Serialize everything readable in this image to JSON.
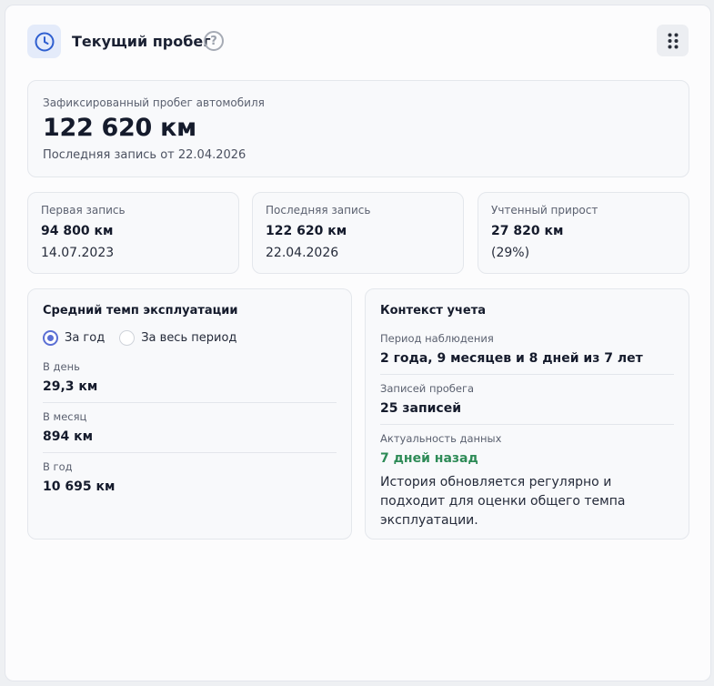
{
  "header": {
    "title": "Текущий пробег",
    "help_glyph": "?",
    "clock_icon": "clock-icon",
    "menu_icon": "grip-dots-icon"
  },
  "current": {
    "label": "Зафиксированный пробег автомобиля",
    "value": "122 620 км",
    "last_record": "Последняя запись от 22.04.2026"
  },
  "stats": [
    {
      "label": "Первая запись",
      "value": "94 800 км",
      "sub": "14.07.2023"
    },
    {
      "label": "Последняя запись",
      "value": "122 620 км",
      "sub": "22.04.2026"
    },
    {
      "label": "Учтенный прирост",
      "value": "27 820 км",
      "sub": "(29%)"
    }
  ],
  "tempo": {
    "title": "Средний темп эксплуатации",
    "options": [
      {
        "label": "За год",
        "selected": true
      },
      {
        "label": "За весь период",
        "selected": false
      }
    ],
    "metrics": [
      {
        "label": "В день",
        "value": "29,3 км"
      },
      {
        "label": "В месяц",
        "value": "894 км"
      },
      {
        "label": "В год",
        "value": "10 695 км"
      }
    ]
  },
  "context": {
    "title": "Контекст учета",
    "period_label": "Период наблюдения",
    "period_value": "2 года, 9 месяцев и 8 дней из 7 лет",
    "records_label": "Записей пробега",
    "records_value": "25 записей",
    "freshness_label": "Актуальность данных",
    "freshness_value": "7 дней назад",
    "note": "История обновляется регулярно и подходит для оценки общего темпа эксплуатации."
  },
  "colors": {
    "accent": "#5b6fd4",
    "fresh_green": "#2e8b57",
    "icon_blue": "#2f5fd0"
  }
}
